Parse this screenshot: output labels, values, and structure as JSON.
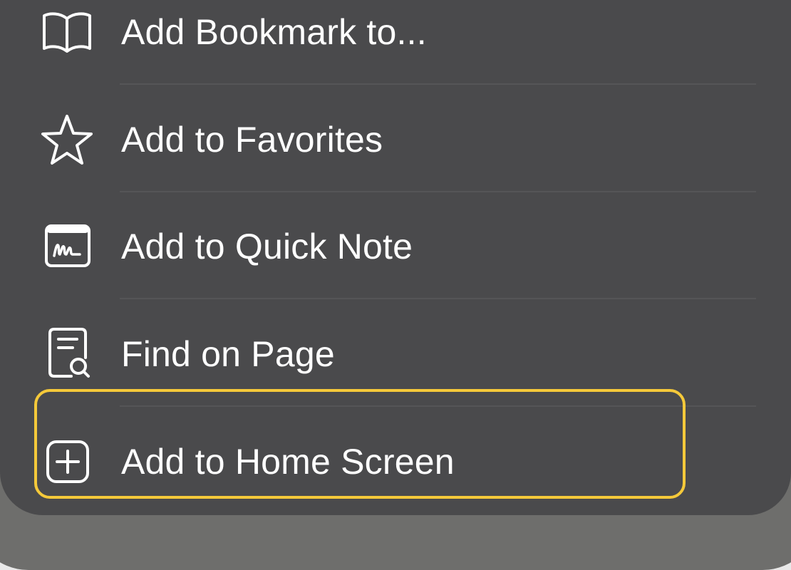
{
  "menu": {
    "items": [
      {
        "label": "Add Bookmark to...",
        "icon": "book-icon"
      },
      {
        "label": "Add to Favorites",
        "icon": "star-icon"
      },
      {
        "label": "Add to Quick Note",
        "icon": "quick-note-icon"
      },
      {
        "label": "Find on Page",
        "icon": "find-document-icon"
      },
      {
        "label": "Add to Home Screen",
        "icon": "plus-square-icon"
      }
    ]
  },
  "highlight": {
    "color": "#f5c93a",
    "target": "Add to Home Screen"
  },
  "colors": {
    "menu_background": "#4a4a4c",
    "text": "#ffffff",
    "divider": "#555557"
  }
}
